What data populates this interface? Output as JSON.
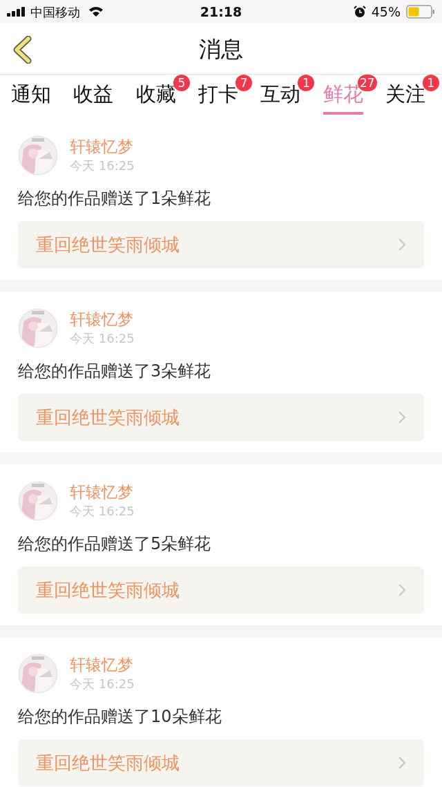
{
  "status_bar": {
    "carrier": "中国移动",
    "time": "21:18",
    "battery": "45%"
  },
  "header": {
    "title": "消息"
  },
  "tabs": [
    {
      "label": "通知",
      "selected": false
    },
    {
      "label": "收益",
      "selected": false
    },
    {
      "label": "收藏",
      "selected": false,
      "badge": "5"
    },
    {
      "label": "打卡",
      "selected": false,
      "badge": "7"
    },
    {
      "label": "互动",
      "selected": false,
      "badge": "1"
    },
    {
      "label": "鲜花",
      "selected": true,
      "badge": "27"
    },
    {
      "label": "关注",
      "selected": false,
      "badge": "1"
    }
  ],
  "messages": [
    {
      "user": "轩辕忆梦",
      "time": "今天 16:25",
      "text": "给您的作品赠送了1朵鲜花",
      "work": "重回绝世笑雨倾城"
    },
    {
      "user": "轩辕忆梦",
      "time": "今天 16:25",
      "text": "给您的作品赠送了3朵鲜花",
      "work": "重回绝世笑雨倾城"
    },
    {
      "user": "轩辕忆梦",
      "time": "今天 16:25",
      "text": "给您的作品赠送了5朵鲜花",
      "work": "重回绝世笑雨倾城"
    },
    {
      "user": "轩辕忆梦",
      "time": "今天 16:25",
      "text": "给您的作品赠送了10朵鲜花",
      "work": "重回绝世笑雨倾城"
    }
  ]
}
